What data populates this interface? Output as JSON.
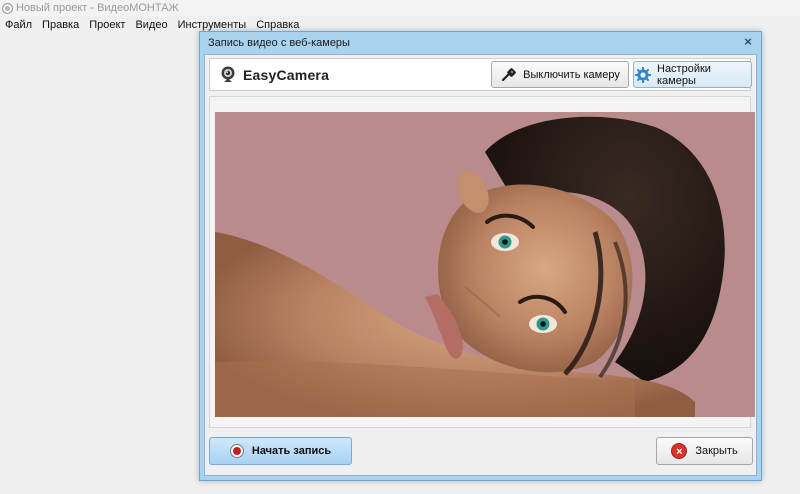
{
  "app": {
    "title": "Новый проект - ВидеоМОНТАЖ"
  },
  "menu": [
    "Файл",
    "Правка",
    "Проект",
    "Видео",
    "Инструменты",
    "Справка"
  ],
  "dialog": {
    "title": "Запись видео с веб-камеры",
    "close_glyph": "×",
    "camera_name": "EasyCamera",
    "disable_camera_label": "Выключить камеру",
    "camera_settings_label": "Настройки камеры",
    "start_recording_label": "Начать запись",
    "close_label": "Закрыть"
  },
  "icons": {
    "app": "app-icon",
    "webcam": "webcam-icon",
    "disable": "camera-off-icon",
    "settings": "gear-icon",
    "record": "record-icon",
    "close": "close-circle-icon"
  },
  "colors": {
    "dialog_frame": "#a9d2ef",
    "record_button": "#a8d3f3",
    "record_dot": "#c81d1d",
    "close_icon": "#d9342b"
  }
}
